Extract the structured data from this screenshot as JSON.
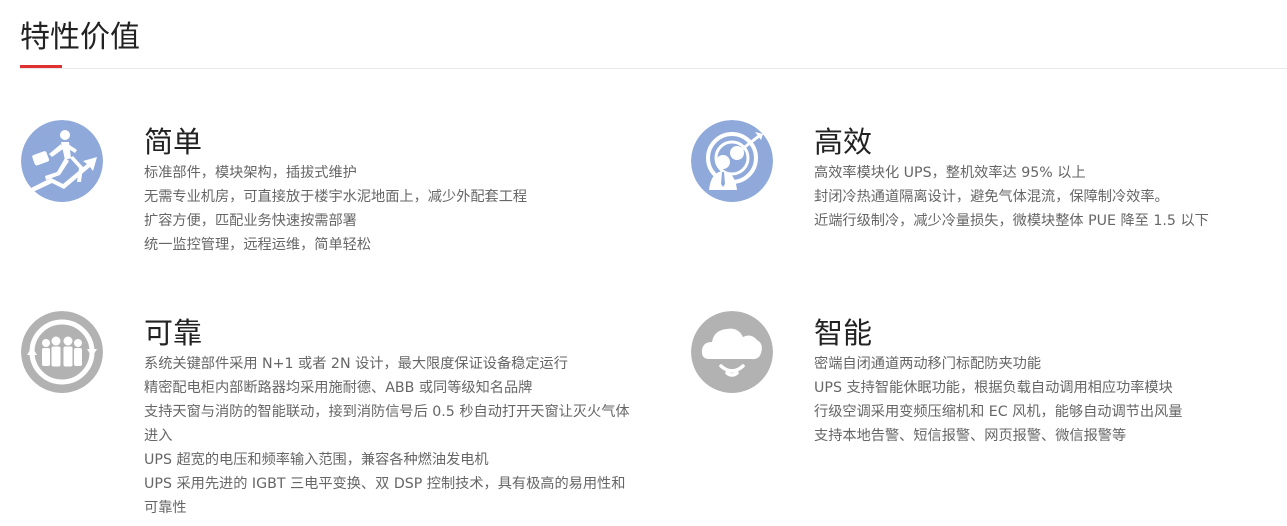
{
  "section": {
    "title": "特性价值"
  },
  "colors": {
    "accent": "#e03131",
    "icon_blue": "#8fa9da",
    "icon_gray": "#b2b2b2"
  },
  "features": [
    {
      "key": "simple",
      "icon": "runner-arrow-icon",
      "title": "简单",
      "lines": [
        "标准部件，模块架构，插拔式维护",
        "无需专业机房，可直接放于楼宇水泥地面上，减少外配套工程",
        "扩容方便，匹配业务快速按需部署",
        "统一监控管理，远程运维，简单轻松"
      ]
    },
    {
      "key": "efficient",
      "icon": "target-person-icon",
      "title": "高效",
      "lines": [
        "高效率模块化 UPS，整机效率达 95% 以上",
        "封闭冷热通道隔离设计，避免气体混流，保障制冷效率。",
        "近端行级制冷，减少冷量损失，微模块整体 PUE 降至 1.5 以下"
      ]
    },
    {
      "key": "reliable",
      "icon": "team-cycle-icon",
      "title": "可靠",
      "lines": [
        "系统关键部件采用 N+1 或者 2N 设计，最大限度保证设备稳定运行",
        "精密配电柜内部断路器均采用施耐德、ABB 或同等级知名品牌",
        "支持天窗与消防的智能联动，接到消防信号后 0.5 秒自动打开天窗让灭火气体进入",
        "UPS 超宽的电压和频率输入范围，兼容各种燃油发电机",
        "UPS 采用先进的 IGBT 三电平变换、双 DSP 控制技术，具有极高的易用性和可靠性"
      ]
    },
    {
      "key": "smart",
      "icon": "cloud-icon",
      "title": "智能",
      "lines": [
        "密端自闭通道两动移门标配防夹功能",
        "UPS 支持智能休眠功能，根据负载自动调用相应功率模块",
        "行级空调采用变频压缩机和 EC 风机，能够自动调节出风量",
        "支持本地告警、短信报警、网页报警、微信报警等"
      ]
    }
  ]
}
